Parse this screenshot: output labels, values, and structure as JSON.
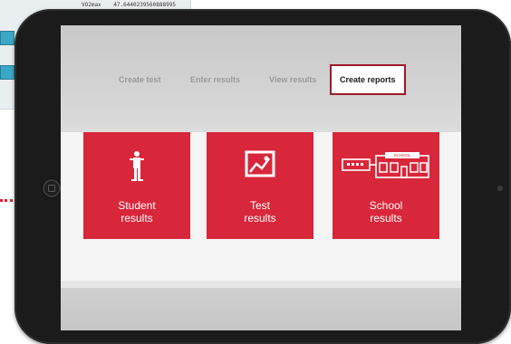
{
  "background": {
    "row_key": "VO2max",
    "row_value": "47.6440239560888995"
  },
  "nav": {
    "tabs": [
      {
        "label": "Create test"
      },
      {
        "label": "Enter results"
      },
      {
        "label": "View results"
      },
      {
        "label": "Create reports"
      }
    ],
    "active_index": 3
  },
  "tiles": [
    {
      "line1": "Student",
      "line2": "results",
      "icon": "student-figure-icon"
    },
    {
      "line1": "Test",
      "line2": "results",
      "icon": "chart-image-icon"
    },
    {
      "line1": "School",
      "line2": "results",
      "icon": "school-building-icon",
      "sign": "SCHOOL"
    }
  ],
  "colors": {
    "tile": "#d8273a",
    "active_border": "#9e1b2b",
    "connector": "#e0203a"
  }
}
